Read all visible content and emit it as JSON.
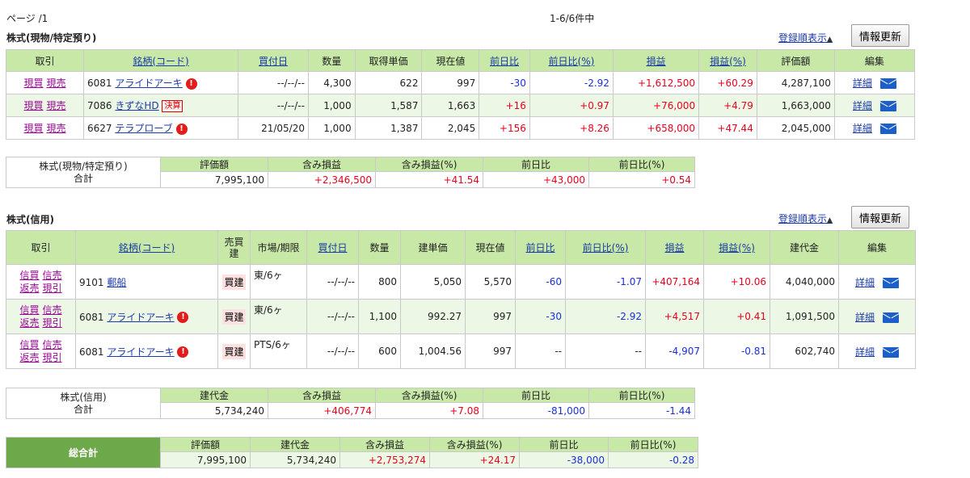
{
  "header": {
    "page": "ページ /1",
    "count": "1-6/6件中"
  },
  "labels": {
    "sort": "登録順表示",
    "sort_icon": "▲",
    "refresh": "情報更新",
    "detail": "詳細",
    "genbai": "現買",
    "genuri": "現売",
    "shinkai": "信買",
    "shinuri": "信売",
    "hensai": "返売",
    "genbiki": "現引",
    "kessan": "決算",
    "kaidate": "買建"
  },
  "cash": {
    "title": "株式(現物/特定預り)",
    "headers": [
      "取引",
      "銘柄(コード)",
      "買付日",
      "数量",
      "取得単価",
      "現在値",
      "前日比",
      "前日比(%)",
      "損益",
      "損益(%)",
      "評価額",
      "編集"
    ],
    "rows": [
      {
        "code": "6081",
        "name": "アライドアーキ",
        "badge": "red",
        "date": "--/--/--",
        "qty": "4,300",
        "cost": "622",
        "price": "997",
        "chg": "-30",
        "chgp": "-2.92",
        "pl": "+1,612,500",
        "plp": "+60.29",
        "value": "4,287,100"
      },
      {
        "code": "7086",
        "name": "きずなHD",
        "badge": "kessan",
        "date": "--/--/--",
        "qty": "1,000",
        "cost": "1,587",
        "price": "1,663",
        "chg": "+16",
        "chgp": "+0.97",
        "pl": "+76,000",
        "plp": "+4.79",
        "value": "1,663,000"
      },
      {
        "code": "6627",
        "name": "テラプローブ",
        "badge": "red",
        "date": "21/05/20",
        "qty": "1,000",
        "cost": "1,387",
        "price": "2,045",
        "chg": "+156",
        "chgp": "+8.26",
        "pl": "+658,000",
        "plp": "+47.44",
        "value": "2,045,000"
      }
    ],
    "summary": {
      "label1": "株式(現物/特定預り)",
      "label2": "合計",
      "headers": [
        "評価額",
        "含み損益",
        "含み損益(%)",
        "前日比",
        "前日比(%)"
      ],
      "values": [
        "7,995,100",
        "+2,346,500",
        "+41.54",
        "+43,000",
        "+0.54"
      ]
    }
  },
  "margin": {
    "title": "株式(信用)",
    "headers": [
      "取引",
      "銘柄(コード)",
      "売買建",
      "市場/期限",
      "買付日",
      "数量",
      "建単価",
      "現在値",
      "前日比",
      "前日比(%)",
      "損益",
      "損益(%)",
      "建代金",
      "編集"
    ],
    "rows": [
      {
        "code": "9101",
        "name": "郵船",
        "badge": "",
        "type": "買建",
        "market": "東/6ヶ",
        "date": "--/--/--",
        "qty": "800",
        "cost": "5,050",
        "price": "5,570",
        "chg": "-60",
        "chgp": "-1.07",
        "pl": "+407,164",
        "plp": "+10.06",
        "value": "4,040,000"
      },
      {
        "code": "6081",
        "name": "アライドアーキ",
        "badge": "red",
        "type": "買建",
        "market": "東/6ヶ",
        "date": "--/--/--",
        "qty": "1,100",
        "cost": "992.27",
        "price": "997",
        "chg": "-30",
        "chgp": "-2.92",
        "pl": "+4,517",
        "plp": "+0.41",
        "value": "1,091,500"
      },
      {
        "code": "6081",
        "name": "アライドアーキ",
        "badge": "red",
        "type": "買建",
        "market": "PTS/6ヶ",
        "date": "--/--/--",
        "qty": "600",
        "cost": "1,004.56",
        "price": "997",
        "chg": "--",
        "chgp": "--",
        "pl": "-4,907",
        "plp": "-0.81",
        "value": "602,740"
      }
    ],
    "summary": {
      "label1": "株式(信用)",
      "label2": "合計",
      "headers": [
        "建代金",
        "含み損益",
        "含み損益(%)",
        "前日比",
        "前日比(%)"
      ],
      "values": [
        "5,734,240",
        "+406,774",
        "+7.08",
        "-81,000",
        "-1.44"
      ]
    }
  },
  "grand": {
    "label": "総合計",
    "headers": [
      "評価額",
      "建代金",
      "含み損益",
      "含み損益(%)",
      "前日比",
      "前日比(%)"
    ],
    "values": [
      "7,995,100",
      "5,734,240",
      "+2,753,274",
      "+24.17",
      "-38,000",
      "-0.28"
    ]
  }
}
